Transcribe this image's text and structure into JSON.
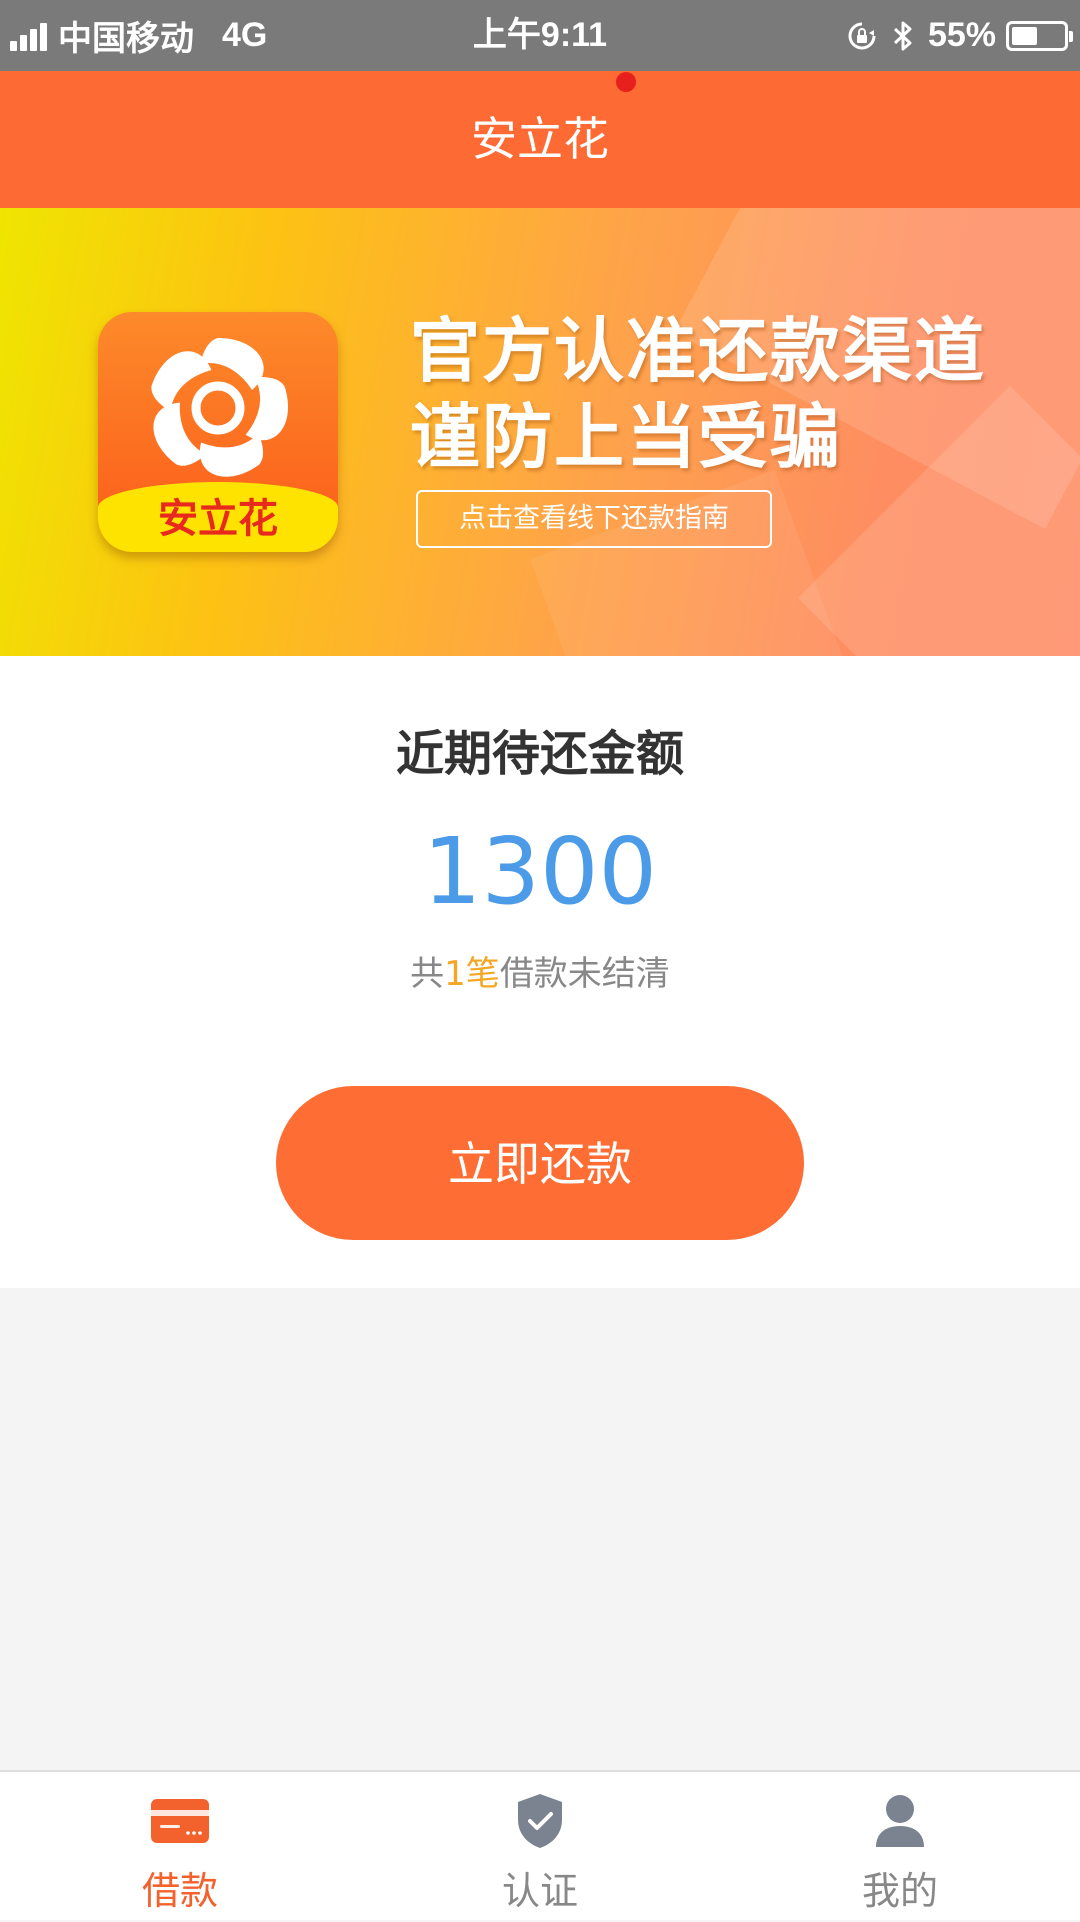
{
  "status_bar": {
    "carrier": "中国移动",
    "network": "4G",
    "time": "上午9:11",
    "battery": "55%",
    "battery_level": 0.55
  },
  "header": {
    "title": "安立花"
  },
  "banner": {
    "logo_text": "安立花",
    "title_line1": "官方认准还款渠道",
    "title_line2": "谨防上当受骗",
    "guide_button": "点击查看线下还款指南"
  },
  "card": {
    "title": "近期待还金额",
    "amount": "1300",
    "sub_prefix": "共",
    "sub_count": "1笔",
    "sub_suffix": "借款未结清",
    "repay_button": "立即还款"
  },
  "tabs": [
    {
      "label": "借款",
      "icon": "card-icon",
      "active": true
    },
    {
      "label": "认证",
      "icon": "shield-check-icon",
      "active": false
    },
    {
      "label": "我的",
      "icon": "person-icon",
      "active": false
    }
  ],
  "colors": {
    "accent": "#fe6a33",
    "amount_blue": "#4b9be8",
    "highlight": "#f5a623",
    "tab_inactive": "#888888"
  }
}
